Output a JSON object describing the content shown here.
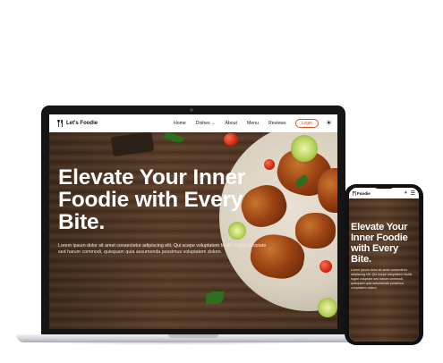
{
  "site": {
    "brand": "Let's Foodie",
    "nav_links": [
      "Home",
      "Dishes",
      "About",
      "Menu",
      "Reviews"
    ],
    "login_label": "Login",
    "hero_title": "Elevate Your Inner Foodie with Every Bite.",
    "hero_text": "Lorem ipsum dolor sit amet consectetur adipiscing elit. Qui scepe voluptatem facilis fugiat voluptate sed harum commodi, quisquam quia assumenda possimus voluptatem dolore."
  },
  "phone": {
    "brand": "Foodie",
    "hero_title": "Elevate Your Inner Foodie with Every Bite.",
    "hero_text": "Lorem ipsum dolor sit amet consectetur adipiscing elit. Qui scepe voluptatem facilis fugiat voluptate sed harum commodi, quisquam quia assumenda possimus voluptatem dolore."
  },
  "icons": {
    "brand": "fork-knife-icon",
    "theme": "sun-icon",
    "menu": "hamburger-icon",
    "dropdown": "chevron-down-icon"
  },
  "colors": {
    "accent": "#d9531e",
    "wood": "#4a3020"
  }
}
